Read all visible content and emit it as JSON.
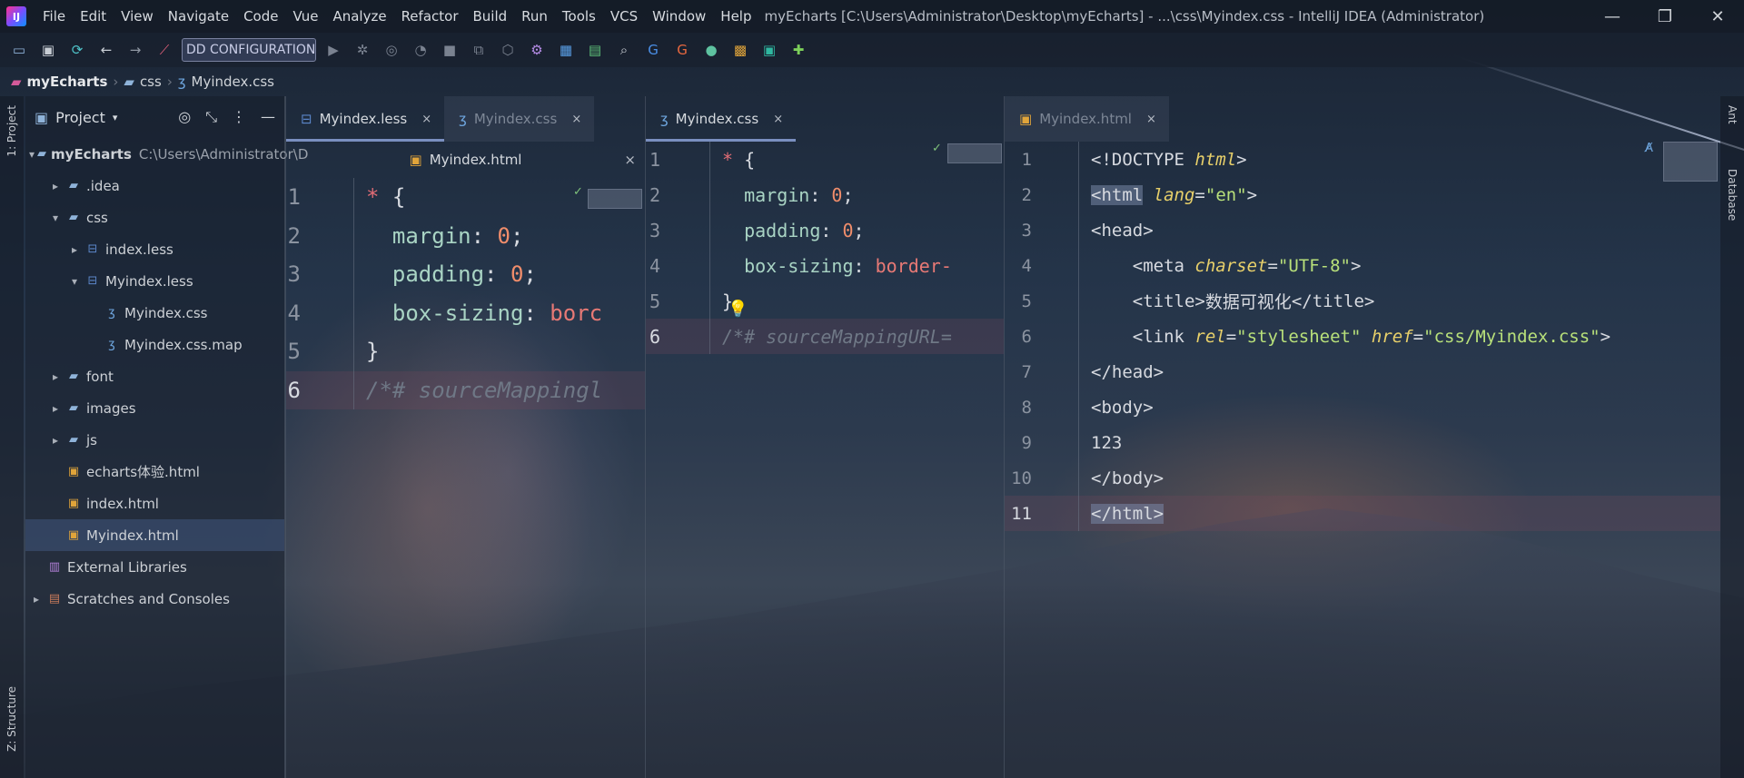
{
  "titlebar": {
    "logo": "IJ",
    "menu": [
      "File",
      "Edit",
      "View",
      "Navigate",
      "Code",
      "Vue",
      "Analyze",
      "Refactor",
      "Build",
      "Run",
      "Tools",
      "VCS",
      "Window",
      "Help"
    ],
    "window_title": "myEcharts [C:\\Users\\Administrator\\Desktop\\myEcharts] - ...\\css\\Myindex.css - IntelliJ IDEA (Administrator)",
    "minimize": "—",
    "restore": "❐",
    "close": "✕"
  },
  "toolbar": {
    "run_config": "DD CONFIGURATION"
  },
  "breadcrumb": [
    "myEcharts",
    "css",
    "Myindex.css"
  ],
  "left_stripe": {
    "project_label": "1: Project",
    "structure_label": "Z: Structure"
  },
  "project": {
    "header": "Project",
    "tree": [
      {
        "label": "myEcharts",
        "hint": "C:\\Users\\Administrator\\D",
        "depth": 0,
        "arrow": "▾",
        "icon": "folder-icon"
      },
      {
        "label": ".idea",
        "depth": 1,
        "arrow": "▸",
        "icon": "folder-icon"
      },
      {
        "label": "css",
        "depth": 1,
        "arrow": "▾",
        "icon": "folder-icon"
      },
      {
        "label": "index.less",
        "depth": 2,
        "arrow": "▸",
        "icon": "less-icon"
      },
      {
        "label": "Myindex.less",
        "depth": 2,
        "arrow": "▾",
        "icon": "less-icon"
      },
      {
        "label": "Myindex.css",
        "depth": 3,
        "arrow": "",
        "icon": "css-icon"
      },
      {
        "label": "Myindex.css.map",
        "depth": 3,
        "arrow": "",
        "icon": "map-icon"
      },
      {
        "label": "font",
        "depth": 1,
        "arrow": "▸",
        "icon": "folder-icon"
      },
      {
        "label": "images",
        "depth": 1,
        "arrow": "▸",
        "icon": "folder-icon"
      },
      {
        "label": "js",
        "depth": 1,
        "arrow": "▸",
        "icon": "folder-icon"
      },
      {
        "label": "echarts体验.html",
        "depth": 1,
        "arrow": "",
        "icon": "html-icon"
      },
      {
        "label": "index.html",
        "depth": 1,
        "arrow": "",
        "icon": "html-icon"
      },
      {
        "label": "Myindex.html",
        "depth": 1,
        "arrow": "",
        "icon": "html-icon",
        "selected": true
      },
      {
        "label": "External Libraries",
        "depth": 0,
        "arrow": "",
        "icon": "library-icon"
      },
      {
        "label": "Scratches and Consoles",
        "depth": 0,
        "arrow": "▸",
        "icon": "scratch-icon"
      }
    ]
  },
  "editor1": {
    "tabs": [
      {
        "label": "Myindex.less",
        "icon": "less-icon",
        "close": "×"
      },
      {
        "label": "Myindex.css",
        "icon": "css-icon",
        "close": "×",
        "dim": true
      }
    ],
    "subtab": {
      "label": "Myindex.html",
      "close": "×"
    },
    "lines": [
      {
        "n": "1",
        "parts": [
          [
            "* ",
            "c-sel"
          ],
          [
            "{",
            "c-brace"
          ]
        ]
      },
      {
        "n": "2",
        "parts": [
          [
            "  margin",
            "c-prop"
          ],
          [
            ": ",
            "c-brace"
          ],
          [
            "0",
            "c-num"
          ],
          [
            ";",
            "c-brace"
          ]
        ]
      },
      {
        "n": "3",
        "parts": [
          [
            "  padding",
            "c-prop"
          ],
          [
            ": ",
            "c-brace"
          ],
          [
            "0",
            "c-num"
          ],
          [
            ";",
            "c-brace"
          ]
        ]
      },
      {
        "n": "4",
        "parts": [
          [
            "  box-sizing",
            "c-prop"
          ],
          [
            ": ",
            "c-brace"
          ],
          [
            "borc",
            "c-str"
          ]
        ]
      },
      {
        "n": "5",
        "parts": [
          [
            "}",
            "c-brace"
          ]
        ]
      },
      {
        "n": "6",
        "parts": [
          [
            "/*# sourceMappingl",
            "c-com"
          ]
        ],
        "current": true
      }
    ]
  },
  "editor2": {
    "tabs": [
      {
        "label": "Myindex.css",
        "icon": "css-icon",
        "close": "×"
      }
    ],
    "lines": [
      {
        "n": "1",
        "parts": [
          [
            "* ",
            "c-sel"
          ],
          [
            "{",
            "c-brace"
          ]
        ]
      },
      {
        "n": "2",
        "parts": [
          [
            "  margin",
            "c-prop"
          ],
          [
            ": ",
            "c-brace"
          ],
          [
            "0",
            "c-num"
          ],
          [
            ";",
            "c-brace"
          ]
        ]
      },
      {
        "n": "3",
        "parts": [
          [
            "  padding",
            "c-prop"
          ],
          [
            ": ",
            "c-brace"
          ],
          [
            "0",
            "c-num"
          ],
          [
            ";",
            "c-brace"
          ]
        ]
      },
      {
        "n": "4",
        "parts": [
          [
            "  box-sizing",
            "c-prop"
          ],
          [
            ": ",
            "c-brace"
          ],
          [
            "border-",
            "c-str"
          ]
        ]
      },
      {
        "n": "5",
        "parts": [
          [
            "}",
            "c-brace"
          ]
        ]
      },
      {
        "n": "6",
        "parts": [
          [
            "/*# sourceMappingURL=",
            "c-com"
          ]
        ],
        "current": true
      }
    ]
  },
  "editor3": {
    "tabs": [
      {
        "label": "Myindex.html",
        "icon": "html-icon",
        "close": "×",
        "dim": true
      }
    ],
    "lines": [
      {
        "n": "1",
        "parts": [
          [
            "<!DOCTYPE ",
            "c-tag"
          ],
          [
            "html",
            "c-attr"
          ],
          [
            ">",
            "c-tag"
          ]
        ]
      },
      {
        "n": "2",
        "parts": [
          [
            "<html",
            "c-tag hl-tag"
          ],
          [
            " ",
            "c-tag"
          ],
          [
            "lang",
            "c-attr"
          ],
          [
            "=",
            "c-tag"
          ],
          [
            "\"en\"",
            "c-val"
          ],
          [
            ">",
            "c-tag"
          ]
        ]
      },
      {
        "n": "3",
        "parts": [
          [
            "<head>",
            "c-tag"
          ]
        ]
      },
      {
        "n": "4",
        "parts": [
          [
            "    <meta ",
            "c-tag"
          ],
          [
            "charset",
            "c-attr"
          ],
          [
            "=",
            "c-tag"
          ],
          [
            "\"UTF-8\"",
            "c-val"
          ],
          [
            ">",
            "c-tag"
          ]
        ]
      },
      {
        "n": "5",
        "parts": [
          [
            "    <title>",
            "c-tag"
          ],
          [
            "数据可视化",
            "c-text"
          ],
          [
            "</title>",
            "c-tag"
          ]
        ]
      },
      {
        "n": "6",
        "parts": [
          [
            "    <link ",
            "c-tag"
          ],
          [
            "rel",
            "c-attr"
          ],
          [
            "=",
            "c-tag"
          ],
          [
            "\"stylesheet\"",
            "c-val"
          ],
          [
            " ",
            "c-tag"
          ],
          [
            "href",
            "c-attr"
          ],
          [
            "=",
            "c-tag"
          ],
          [
            "\"css/Myindex.css\"",
            "c-val"
          ],
          [
            ">",
            "c-tag"
          ]
        ]
      },
      {
        "n": "7",
        "parts": [
          [
            "</head>",
            "c-tag"
          ]
        ]
      },
      {
        "n": "8",
        "parts": [
          [
            "<body>",
            "c-tag"
          ]
        ]
      },
      {
        "n": "9",
        "parts": [
          [
            "123",
            "c-text"
          ]
        ]
      },
      {
        "n": "10",
        "parts": [
          [
            "</body>",
            "c-tag"
          ]
        ]
      },
      {
        "n": "11",
        "parts": [
          [
            "</html>",
            "c-tag hl-tag"
          ]
        ],
        "current": true
      }
    ]
  },
  "right_stripe": {
    "ant_label": "Ant",
    "database_label": "Database"
  },
  "colors": {
    "accent": "#7a8fc0",
    "selection": "#465f8c"
  }
}
